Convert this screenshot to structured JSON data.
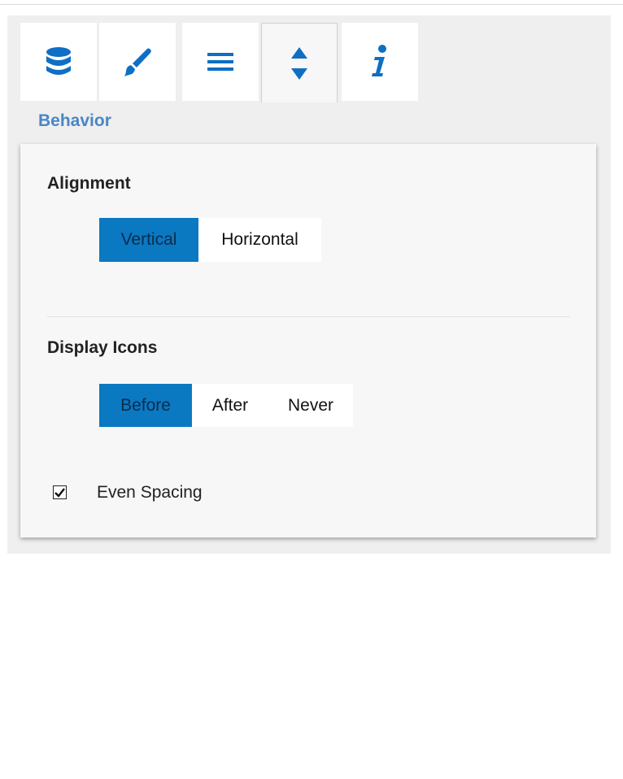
{
  "tabs": [
    {
      "icon": "database-icon"
    },
    {
      "icon": "brush-icon"
    },
    {
      "icon": "list-icon"
    },
    {
      "icon": "sort-arrows-icon",
      "active": true
    },
    {
      "icon": "info-icon"
    }
  ],
  "section": {
    "title": "Behavior"
  },
  "alignment": {
    "label": "Alignment",
    "options": [
      "Vertical",
      "Horizontal"
    ],
    "selected": "Vertical"
  },
  "display_icons": {
    "label": "Display Icons",
    "options": [
      "Before",
      "After",
      "Never"
    ],
    "selected": "Before"
  },
  "even_spacing": {
    "label": "Even Spacing",
    "checked": true
  },
  "colors": {
    "accent": "#0b78c2",
    "icon": "#0e6fc4",
    "section_title": "#4a86c5"
  }
}
